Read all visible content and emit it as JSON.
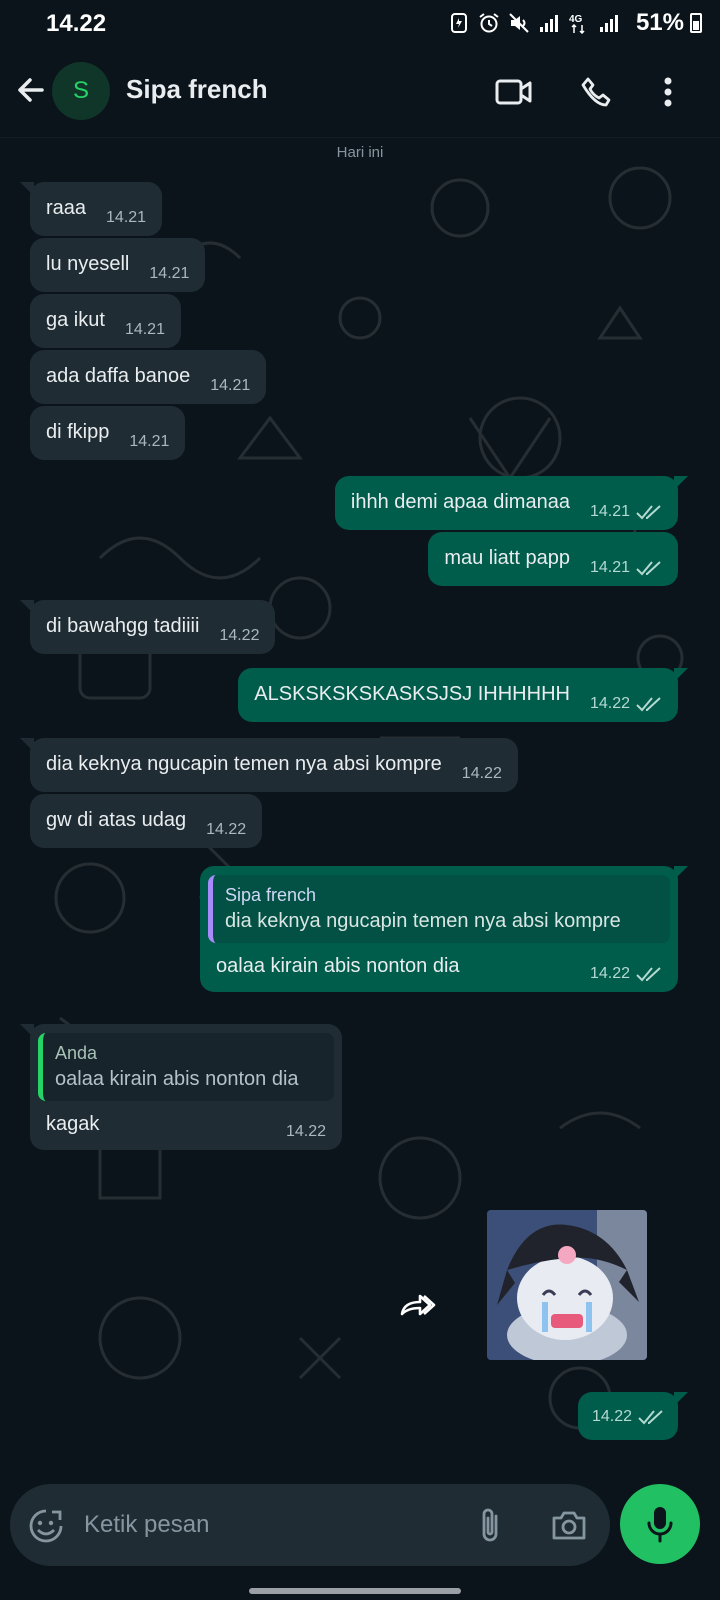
{
  "status": {
    "time": "14.22",
    "battery": "51%"
  },
  "header": {
    "avatar_letter": "S",
    "contact_name": "Sipa french"
  },
  "chat": {
    "date_label": "Hari ini",
    "messages": [
      {
        "dir": "in",
        "text": "raaa",
        "time": "14.21"
      },
      {
        "dir": "in",
        "text": "lu nyesell",
        "time": "14.21"
      },
      {
        "dir": "in",
        "text": "ga ikut",
        "time": "14.21"
      },
      {
        "dir": "in",
        "text": "ada daffa banoe",
        "time": "14.21"
      },
      {
        "dir": "in",
        "text": "di fkipp",
        "time": "14.21"
      },
      {
        "dir": "out",
        "text": "ihhh demi apaa dimanaa",
        "time": "14.21"
      },
      {
        "dir": "out",
        "text": "mau liatt papp",
        "time": "14.21"
      },
      {
        "dir": "in",
        "text": "di bawahgg tadiiii",
        "time": "14.22"
      },
      {
        "dir": "out",
        "text": "ALSKSKSKSKASKSJSJ IHHHHHH",
        "time": "14.22"
      },
      {
        "dir": "in",
        "text": "dia keknya ngucapin temen nya absi kompre",
        "time": "14.22"
      },
      {
        "dir": "in",
        "text": "gw di atas udag",
        "time": "14.22"
      },
      {
        "dir": "out",
        "text": "oalaa kirain abis nonton dia",
        "time": "14.22",
        "quote_name": "Sipa french",
        "quote_text": "dia keknya ngucapin temen nya absi kompre"
      },
      {
        "dir": "in",
        "text": "kagak",
        "time": "14.22",
        "quote_name": "Anda",
        "quote_text": "oalaa kirain abis nonton dia"
      },
      {
        "dir": "out",
        "text": "",
        "time": "14.22",
        "sticker": true
      }
    ]
  },
  "input": {
    "placeholder": "Ketik pesan"
  },
  "icons": {
    "back": "arrow-left-icon",
    "video": "video-call-icon",
    "call": "phone-icon",
    "menu": "more-vert-icon",
    "emoji": "emoji-icon",
    "attach": "paperclip-icon",
    "camera": "camera-icon",
    "mic": "microphone-icon",
    "forward": "forward-icon",
    "read": "double-check-icon"
  },
  "colors": {
    "background": "#0b141a",
    "incoming_bubble": "#1f2c34",
    "outgoing_bubble": "#005c4b",
    "accent": "#21c063"
  }
}
